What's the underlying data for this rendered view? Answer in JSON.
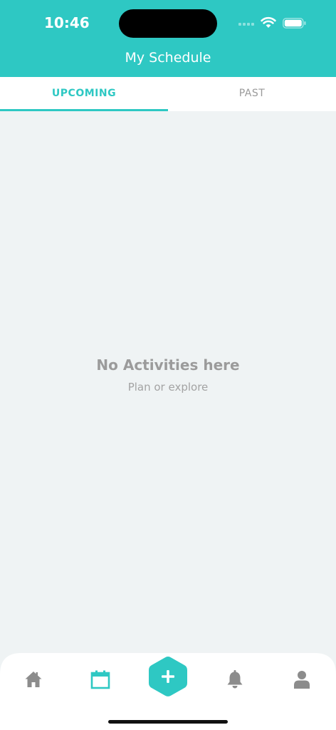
{
  "status": {
    "time": "10:46"
  },
  "header": {
    "title": "My Schedule"
  },
  "tabs": [
    {
      "label": "UPCOMING",
      "selected": true
    },
    {
      "label": "PAST",
      "selected": false
    }
  ],
  "empty_state": {
    "title": "No Activities here",
    "subtitle": "Plan or explore"
  },
  "bottom_nav": {
    "items": [
      {
        "icon": "home-icon",
        "active": false
      },
      {
        "icon": "calendar-icon",
        "active": true
      },
      {
        "icon": "plus-icon",
        "active": false
      },
      {
        "icon": "bell-icon",
        "active": false
      },
      {
        "icon": "person-icon",
        "active": false
      }
    ]
  },
  "colors": {
    "accent": "#2ec8c3",
    "inactive": "#8c8c8c",
    "background": "#eff3f4"
  }
}
